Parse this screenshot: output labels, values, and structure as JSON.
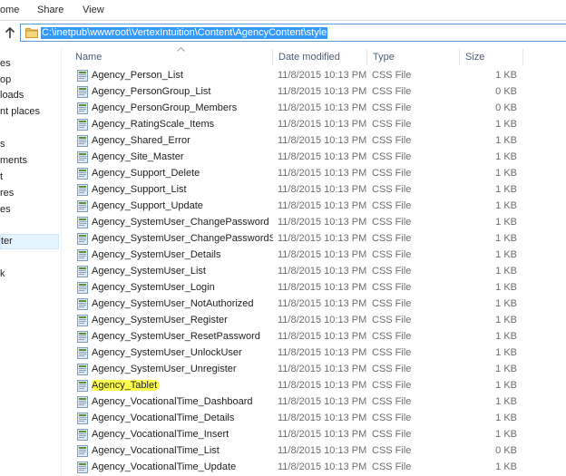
{
  "ribbon": {
    "tabs": [
      "ome",
      "Share",
      "View"
    ]
  },
  "address": {
    "path": "C:\\inetpub\\wwwroot\\VertexIntuition\\Content\\AgencyContent\\style"
  },
  "nav": {
    "items": [
      "es",
      "op",
      "loads",
      "nt places",
      "s",
      "ments",
      "t",
      "res",
      "es",
      "ter",
      "k"
    ],
    "selected_index": 9
  },
  "columns": {
    "name": "Name",
    "date": "Date modified",
    "type": "Type",
    "size": "Size"
  },
  "files": [
    {
      "name": "Agency_Person_List",
      "date": "11/8/2015 10:13 PM",
      "type": "CSS File",
      "size": "1 KB"
    },
    {
      "name": "Agency_PersonGroup_List",
      "date": "11/8/2015 10:13 PM",
      "type": "CSS File",
      "size": "0 KB"
    },
    {
      "name": "Agency_PersonGroup_Members",
      "date": "11/8/2015 10:13 PM",
      "type": "CSS File",
      "size": "0 KB"
    },
    {
      "name": "Agency_RatingScale_Items",
      "date": "11/8/2015 10:13 PM",
      "type": "CSS File",
      "size": "1 KB"
    },
    {
      "name": "Agency_Shared_Error",
      "date": "11/8/2015 10:13 PM",
      "type": "CSS File",
      "size": "1 KB"
    },
    {
      "name": "Agency_Site_Master",
      "date": "11/8/2015 10:13 PM",
      "type": "CSS File",
      "size": "1 KB"
    },
    {
      "name": "Agency_Support_Delete",
      "date": "11/8/2015 10:13 PM",
      "type": "CSS File",
      "size": "1 KB"
    },
    {
      "name": "Agency_Support_List",
      "date": "11/8/2015 10:13 PM",
      "type": "CSS File",
      "size": "1 KB"
    },
    {
      "name": "Agency_Support_Update",
      "date": "11/8/2015 10:13 PM",
      "type": "CSS File",
      "size": "1 KB"
    },
    {
      "name": "Agency_SystemUser_ChangePassword",
      "date": "11/8/2015 10:13 PM",
      "type": "CSS File",
      "size": "1 KB"
    },
    {
      "name": "Agency_SystemUser_ChangePasswordSu...",
      "date": "11/8/2015 10:13 PM",
      "type": "CSS File",
      "size": "1 KB"
    },
    {
      "name": "Agency_SystemUser_Details",
      "date": "11/8/2015 10:13 PM",
      "type": "CSS File",
      "size": "1 KB"
    },
    {
      "name": "Agency_SystemUser_List",
      "date": "11/8/2015 10:13 PM",
      "type": "CSS File",
      "size": "1 KB"
    },
    {
      "name": "Agency_SystemUser_Login",
      "date": "11/8/2015 10:13 PM",
      "type": "CSS File",
      "size": "1 KB"
    },
    {
      "name": "Agency_SystemUser_NotAuthorized",
      "date": "11/8/2015 10:13 PM",
      "type": "CSS File",
      "size": "1 KB"
    },
    {
      "name": "Agency_SystemUser_Register",
      "date": "11/8/2015 10:13 PM",
      "type": "CSS File",
      "size": "1 KB"
    },
    {
      "name": "Agency_SystemUser_ResetPassword",
      "date": "11/8/2015 10:13 PM",
      "type": "CSS File",
      "size": "1 KB"
    },
    {
      "name": "Agency_SystemUser_UnlockUser",
      "date": "11/8/2015 10:13 PM",
      "type": "CSS File",
      "size": "1 KB"
    },
    {
      "name": "Agency_SystemUser_Unregister",
      "date": "11/8/2015 10:13 PM",
      "type": "CSS File",
      "size": "1 KB"
    },
    {
      "name": "Agency_Tablet",
      "date": "11/8/2015 10:13 PM",
      "type": "CSS File",
      "size": "1 KB",
      "highlighted": true
    },
    {
      "name": "Agency_VocationalTime_Dashboard",
      "date": "11/8/2015 10:13 PM",
      "type": "CSS File",
      "size": "1 KB"
    },
    {
      "name": "Agency_VocationalTime_Details",
      "date": "11/8/2015 10:13 PM",
      "type": "CSS File",
      "size": "1 KB"
    },
    {
      "name": "Agency_VocationalTime_Insert",
      "date": "11/8/2015 10:13 PM",
      "type": "CSS File",
      "size": "1 KB"
    },
    {
      "name": "Agency_VocationalTime_List",
      "date": "11/8/2015 10:13 PM",
      "type": "CSS File",
      "size": "0 KB"
    },
    {
      "name": "Agency_VocationalTime_Update",
      "date": "11/8/2015 10:13 PM",
      "type": "CSS File",
      "size": "1 KB"
    }
  ],
  "colors": {
    "address_selection": "#3399ff",
    "nav_selected_bg": "#e5f3ff",
    "header_text": "#4c607a",
    "highlighter": "#ffff66"
  },
  "icons": {
    "up": "up-arrow-icon",
    "folder": "folder-icon",
    "file": "css-file-icon"
  }
}
